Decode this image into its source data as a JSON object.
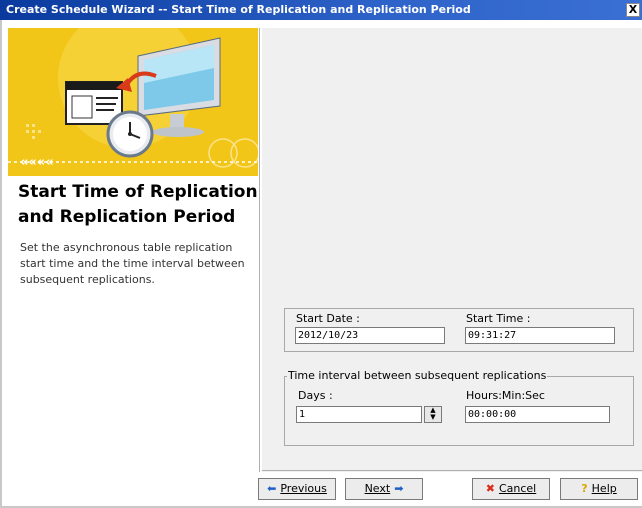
{
  "window": {
    "title": "Create Schedule Wizard -- Start Time of Replication and Replication Period",
    "close_label": "X"
  },
  "step": {
    "title_line1": "Start Time of Replication",
    "title_line2": "and Replication Period",
    "desc_line1": "Set the asynchronous table replication",
    "desc_line2": "start time and the time interval between",
    "desc_line3": "subsequent replications."
  },
  "start": {
    "date_label": "Start Date :",
    "date_value": "2012/10/23",
    "time_label": "Start Time :",
    "time_value": "09:31:27"
  },
  "interval": {
    "legend": "Time interval between subsequent replications",
    "days_label": "Days :",
    "days_value": "1",
    "hms_label": "Hours:Min:Sec",
    "hms_value": "00:00:00"
  },
  "buttons": {
    "previous": "Previous",
    "next": "Next",
    "cancel": "Cancel",
    "help": "Help"
  },
  "colors": {
    "banner": "#f2c618",
    "titlebar": "#0a3a9e"
  }
}
